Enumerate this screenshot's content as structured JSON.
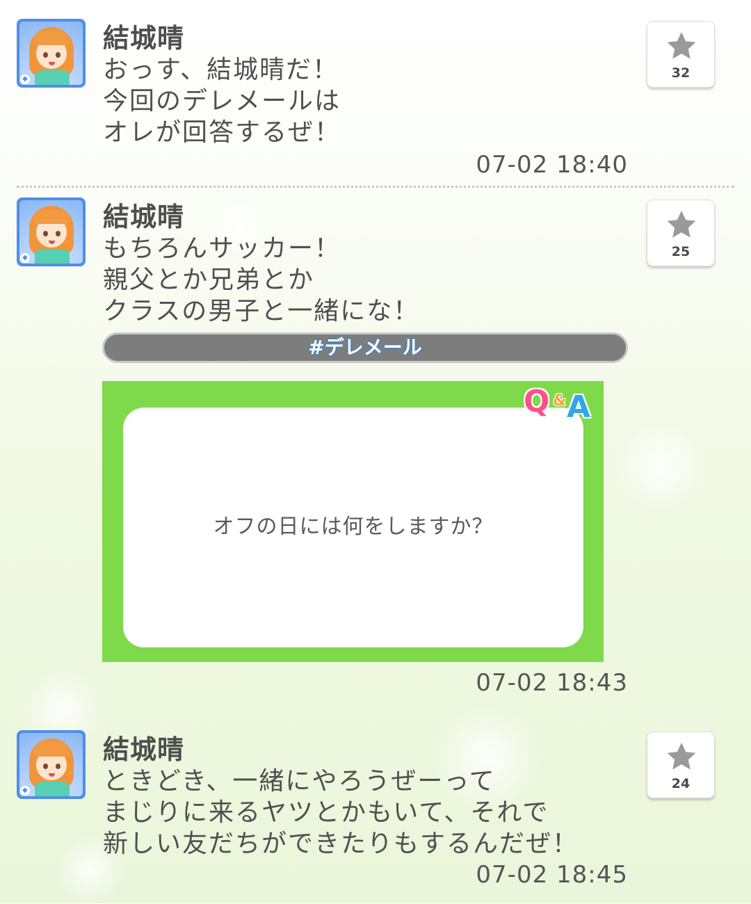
{
  "posts": [
    {
      "author": "結城晴",
      "message": "おっす、結城晴だ！\n今回のデレメールは\nオレが回答するぜ！",
      "timestamp": "07-02 18:40",
      "likes": "32"
    },
    {
      "author": "結城晴",
      "message": "もちろんサッカー！\n親父とか兄弟とか\nクラスの男子と一緒にな！",
      "hashtag": "#デレメール",
      "qa_card": {
        "logo_q": "Q",
        "logo_amp": "&",
        "logo_a": "A",
        "question": "オフの日には何をしますか？"
      },
      "timestamp": "07-02 18:43",
      "likes": "25"
    },
    {
      "author": "結城晴",
      "message": "ときどき、一緒にやろうぜーって\nまじりに来るヤツとかもいて、それで\n新しい友だちができたりもするんだぜ！",
      "timestamp": "07-02 18:45",
      "likes": "24"
    }
  ],
  "colors": {
    "avatar_frame": "#4f8fe6",
    "qa_card_bg": "#7ed94b",
    "hashtag_bg": "#7d7d7d",
    "star": "#9a9a9a"
  },
  "icons": {
    "like": "star-icon",
    "avatar_badge": "diamond-icon"
  }
}
